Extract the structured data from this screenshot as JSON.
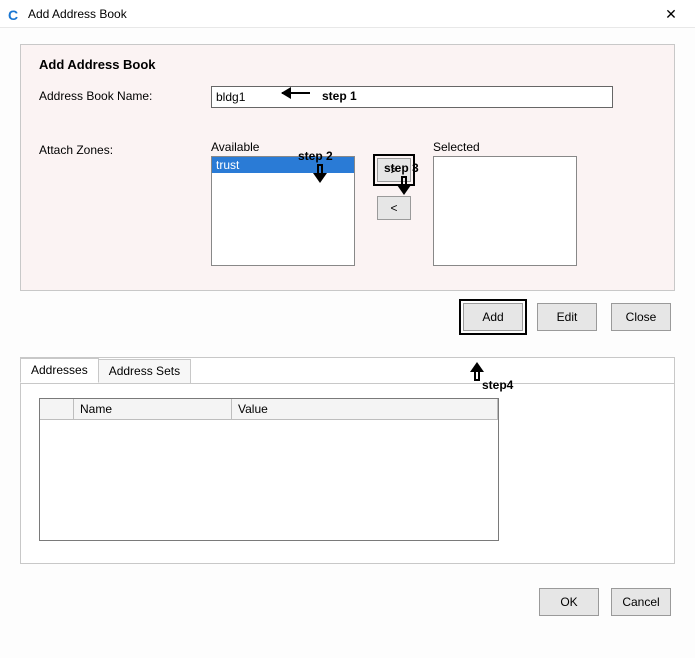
{
  "titlebar": {
    "app_icon_glyph": "C",
    "title": "Add Address Book",
    "close_glyph": "✕"
  },
  "panel": {
    "heading": "Add Address Book",
    "name_label": "Address Book Name:",
    "name_value": "bldg1",
    "zones_label": "Attach Zones:",
    "available_label": "Available",
    "selected_label": "Selected",
    "available_items": [
      "trust"
    ],
    "selected_items": [],
    "move_right_label": ">",
    "move_left_label": "<"
  },
  "actions": {
    "add": "Add",
    "edit": "Edit",
    "close": "Close"
  },
  "tabs": {
    "addresses": "Addresses",
    "address_sets": "Address Sets"
  },
  "grid": {
    "col_name": "Name",
    "col_value": "Value"
  },
  "footer": {
    "ok": "OK",
    "cancel": "Cancel"
  },
  "annotations": {
    "step1": "step 1",
    "step2": "step 2",
    "step3": "step 3",
    "step4": "step4"
  }
}
